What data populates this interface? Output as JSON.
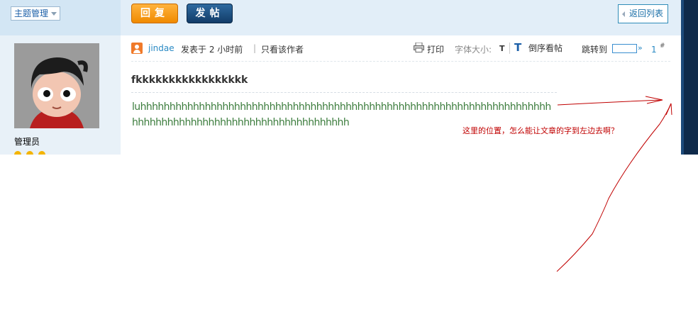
{
  "toolbar": {
    "topic_manage": "主题管理",
    "reply_label": "回复",
    "post_label": "发帖",
    "back_label": "返回列表"
  },
  "sidebar": {
    "role": "管理员"
  },
  "post_header": {
    "author": "jindae",
    "posted_time": "发表于  2 小时前",
    "separator": "|",
    "only_author": "只看该作者",
    "print": "打印",
    "font_size_label": "字体大小:",
    "font_small": "T",
    "font_large": "T",
    "reverse_order": "倒序看帖",
    "jump_to": "跳转到",
    "jump_go": "»",
    "page_number": "1",
    "floor_mark": "#"
  },
  "post": {
    "title": "fkkkkkkkkkkkkkkkkk",
    "body_line1": "luhhhhhhhhhhhhhhhhhhhhhhhhhhhhhhhhhhhhhhhhhhhhhhhhhhhhhhhhhhhhhhhhhhhhhh",
    "body_line2": "hhhhhhhhhhhhhhhhhhhhhhhhhhhhhhhhhhhhh"
  },
  "annotation": {
    "text": "这里的位置，怎么能让文章的字到左边去啊？",
    "color": "#c00000"
  },
  "colors": {
    "reply_button": "#f39200",
    "post_button": "#16426f",
    "link_blue": "#2a8ac4",
    "body_text_green": "#3b7c3c"
  }
}
